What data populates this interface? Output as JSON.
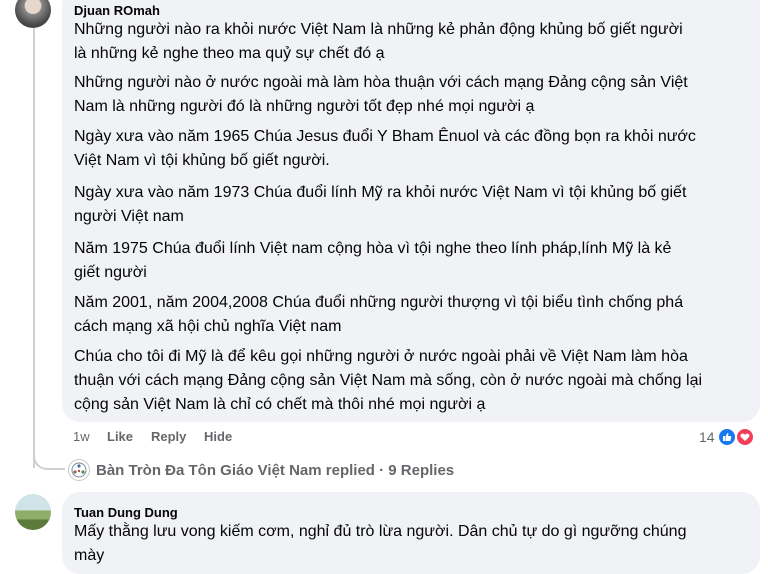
{
  "comment1": {
    "author": "Djuan ROmah",
    "paragraphs": [
      [
        "Những người nào ra khỏi nước Việt Nam là những kẻ phản động khủng bố giết người",
        "là những kẻ nghe theo ma quỷ sự chết đó ạ"
      ],
      [
        "Những người nào ở nước ngoài mà làm hòa thuận với cách mạng Đảng cộng sản Việt",
        "Nam là những người đó là những người tốt đẹp nhé mọi người ạ"
      ],
      [
        "Ngày xưa vào năm 1965 Chúa Jesus đuổi Y Bham Ênuol và các đồng bọn ra khỏi nước",
        "Việt Nam vì tội khủng bố giết người."
      ],
      [
        "Ngày xưa vào năm 1973 Chúa đuổi lính Mỹ ra khỏi nước Việt Nam vì tội khủng bố giết",
        "người Việt nam"
      ],
      [
        "Năm 1975 Chúa đuổi lính Việt nam cộng hòa vì tội nghe theo lính pháp,lính Mỹ là kẻ",
        "giết người"
      ],
      [
        "Năm 2001, năm 2004,2008 Chúa đuổi những người thượng vì tội biểu tình chống phá",
        "cách mạng xã hội chủ nghĩa Việt nam"
      ],
      [
        "Chúa cho tôi đi Mỹ là để kêu gọi những người ở nước ngoài phải về Việt Nam làm hòa",
        "thuận với cách mạng Đảng cộng sản Việt Nam mà sống, còn ở nước ngoài mà chống lại",
        "cộng sản Việt Nam là chỉ có chết mà thôi nhé mọi người ạ"
      ]
    ],
    "time": "1w",
    "like_label": "Like",
    "reply_label": "Reply",
    "hide_label": "Hide",
    "reaction_count": "14"
  },
  "replies_row": {
    "text": "Bàn Tròn Đa Tôn Giáo Việt Nam replied · 9 Replies"
  },
  "comment2": {
    "author": "Tuan Dung Dung",
    "lines": [
      "Mấy thằng lưu vong kiếm cơm, nghỉ đủ trò lừa người. Dân chủ tự do gì ngưỡng chúng",
      "mày"
    ]
  },
  "colors": {
    "bubble": "#f0f2f5",
    "like": "#1877f2",
    "love": "#f33e58",
    "secondary_text": "#65676b"
  },
  "icons": [
    "like-reaction-icon",
    "love-reaction-icon",
    "page-avatar-icon"
  ]
}
